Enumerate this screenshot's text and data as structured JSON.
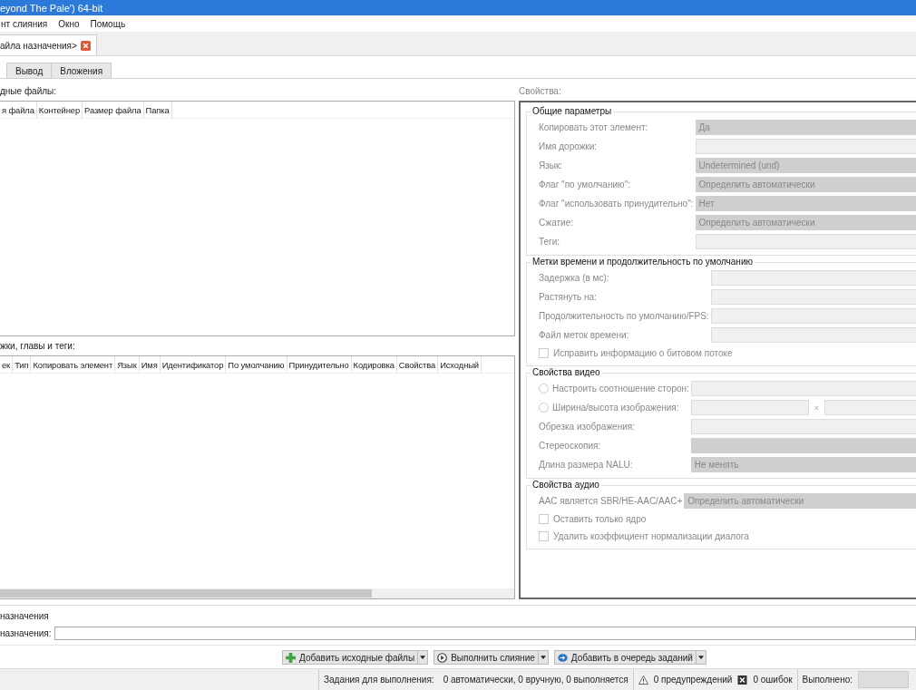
{
  "window": {
    "title": "eyond The Pale') 64-bit"
  },
  "menu": [
    "нт слияния",
    "Окно",
    "Помощь"
  ],
  "file_tabs": [
    {
      "label": "айла назначения>",
      "selected": true
    }
  ],
  "tabs": [
    {
      "label": "Вывод",
      "selected": false
    },
    {
      "label": "Вложения",
      "selected": false
    }
  ],
  "source_files": {
    "label": "дные файлы:",
    "columns": [
      "я файла",
      "Контейнер",
      "Размер файла",
      "Папка"
    ]
  },
  "tracks": {
    "label": "жки, главы и теги:",
    "columns": [
      "ек",
      "Тип",
      "Копировать элемент",
      "Язык",
      "Имя",
      "Идентификатор",
      "По умолчанию",
      "Принудительно",
      "Кодировка",
      "Свойства",
      "Исходный"
    ]
  },
  "properties": {
    "label": "Свойства:",
    "groups": [
      {
        "title": "Общие параметры",
        "rows": [
          {
            "kind": "combo",
            "label": "Копировать этот элемент:",
            "value": "Да"
          },
          {
            "kind": "text",
            "label": "Имя дорожки:"
          },
          {
            "kind": "combo",
            "label": "Язык:",
            "value": "Undetermined (und)"
          },
          {
            "kind": "combo",
            "label": "Флаг \"по умолчанию\":",
            "value": "Определить автоматически"
          },
          {
            "kind": "combo",
            "label": "Флаг \"использовать принудительно\":",
            "value": "Нет"
          },
          {
            "kind": "combo",
            "label": "Сжатие:",
            "value": "Определить автоматически"
          },
          {
            "kind": "text",
            "label": "Теги:"
          }
        ]
      },
      {
        "title": "Метки времени и продолжительность по умолчанию",
        "rows": [
          {
            "kind": "text",
            "label": "Задержка (в мс):"
          },
          {
            "kind": "text",
            "label": "Растянуть на:"
          },
          {
            "kind": "text",
            "label": "Продолжительность по умолчанию/FPS:"
          },
          {
            "kind": "text",
            "label": "Файл меток времени:"
          },
          {
            "kind": "check",
            "label": "Исправить информацию о битовом потоке",
            "checked": false
          }
        ]
      },
      {
        "title": "Свойства видео",
        "rows": [
          {
            "kind": "radio",
            "label": "Настроить соотношение сторон:",
            "selected": false
          },
          {
            "kind": "radio_pair",
            "label": "Ширина/высота изображения:",
            "selected": false,
            "separator": "×"
          },
          {
            "kind": "text",
            "label": "Обрезка изображения:"
          },
          {
            "kind": "combo",
            "label": "Стереоскопия:"
          },
          {
            "kind": "combo",
            "label": "Длина размера NALU:",
            "value": "Не менять"
          }
        ]
      },
      {
        "title": "Свойства аудио",
        "rows": [
          {
            "kind": "combo",
            "label": "AAC является SBR/HE-AAC/AAC+",
            "value": "Определить автоматически"
          },
          {
            "kind": "check",
            "label": "Оставить только ядро",
            "checked": false
          },
          {
            "kind": "check",
            "label": "Удалить коэффициент нормализации диалога",
            "checked": false
          }
        ]
      }
    ]
  },
  "destination": {
    "group_title": "назначения",
    "label": "назначения:"
  },
  "actions": [
    {
      "label": "Добавить исходные файлы"
    },
    {
      "label": "Выполнить слияние"
    },
    {
      "label": "Добавить в очередь заданий"
    }
  ],
  "status_bar": {
    "jobs_label": "Задания для выполнения:",
    "jobs_value": "0 автоматически, 0 вручную, 0 выполняется",
    "warnings": "0 предупреждений",
    "errors": "0 ошибок",
    "done_label": "Выполнено:",
    "progress": {
      "level": 0
    }
  }
}
